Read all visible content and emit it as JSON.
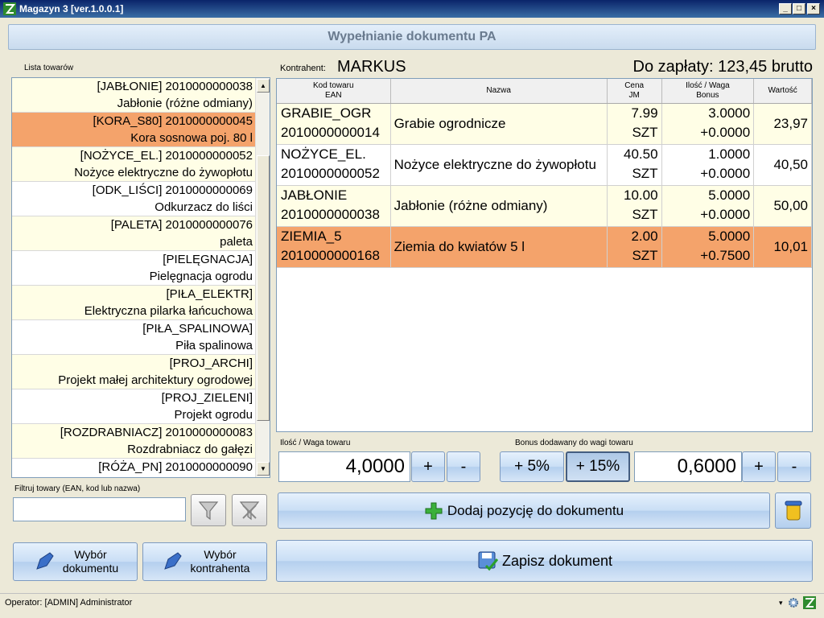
{
  "window": {
    "title": "Magazyn 3 [ver.1.0.0.1]"
  },
  "header": {
    "title": "Wypełnianie dokumentu PA"
  },
  "products": {
    "label": "Lista towarów",
    "items": [
      {
        "code": "[JABŁONIE] 2010000000038",
        "name": "Jabłonie (różne odmiany)",
        "style": "y"
      },
      {
        "code": "[KORA_S80] 2010000000045",
        "name": "Kora sosnowa poj. 80 l",
        "style": "sel"
      },
      {
        "code": "[NOŻYCE_EL.] 2010000000052",
        "name": "Nożyce elektryczne do żywopłotu",
        "style": "y"
      },
      {
        "code": "[ODK_LIŚCI] 2010000000069",
        "name": "Odkurzacz do liści",
        "style": "w"
      },
      {
        "code": "[PALETA] 2010000000076",
        "name": "paleta",
        "style": "y"
      },
      {
        "code": "[PIELĘGNACJA]",
        "name": "Pielęgnacja ogrodu",
        "style": "w"
      },
      {
        "code": "[PIŁA_ELEKTR]",
        "name": "Elektryczna pilarka łańcuchowa",
        "style": "y"
      },
      {
        "code": "[PIŁA_SPALINOWA]",
        "name": "Piła spalinowa",
        "style": "w"
      },
      {
        "code": "[PROJ_ARCHI]",
        "name": "Projekt małej architektury ogrodowej",
        "style": "y"
      },
      {
        "code": "[PROJ_ZIELENI]",
        "name": "Projekt ogrodu",
        "style": "w"
      },
      {
        "code": "[ROZDRABNIACZ] 2010000000083",
        "name": "Rozdrabniacz do gałęzi",
        "style": "y"
      },
      {
        "code": "[RÓŻA_PN] 2010000000090",
        "name": "",
        "style": "w"
      }
    ]
  },
  "filter": {
    "label": "Filtruj towary (EAN, kod lub nazwa)",
    "value": ""
  },
  "buttons": {
    "choose_doc_l1": "Wybór",
    "choose_doc_l2": "dokumentu",
    "choose_contr_l1": "Wybór",
    "choose_contr_l2": "kontrahenta",
    "add_position": "Dodaj pozycję do dokumentu",
    "save_doc": "Zapisz dokument",
    "qty_plus": "+",
    "qty_minus": "-",
    "bonus5": "+ 5%",
    "bonus15": "+ 15%",
    "bonus_plus": "+",
    "bonus_minus": "-"
  },
  "contractor": {
    "label": "Kontrahent:",
    "value": "MARKUS"
  },
  "to_pay": "Do zapłaty: 123,45 brutto",
  "table": {
    "headers": {
      "code_l1": "Kod towaru",
      "code_l2": "EAN",
      "name": "Nazwa",
      "price_l1": "Cena",
      "price_l2": "JM",
      "qty_l1": "Ilość / Waga",
      "qty_l2": "Bonus",
      "value": "Wartość"
    },
    "rows": [
      {
        "code": "GRABIE_OGR",
        "ean": "2010000000014",
        "name": "Grabie ogrodnicze",
        "price": "7.99",
        "unit": "SZT",
        "qty": "3.0000",
        "bonus": "+0.0000",
        "value": "23,97",
        "style": "y"
      },
      {
        "code": "NOŻYCE_EL.",
        "ean": "2010000000052",
        "name": "Nożyce elektryczne do żywopłotu",
        "price": "40.50",
        "unit": "SZT",
        "qty": "1.0000",
        "bonus": "+0.0000",
        "value": "40,50",
        "style": "w"
      },
      {
        "code": "JABŁONIE",
        "ean": "2010000000038",
        "name": "Jabłonie (różne odmiany)",
        "price": "10.00",
        "unit": "SZT",
        "qty": "5.0000",
        "bonus": "+0.0000",
        "value": "50,00",
        "style": "y"
      },
      {
        "code": "ZIEMIA_5",
        "ean": "2010000000168",
        "name": "Ziemia do kwiatów 5 l",
        "price": "2.00",
        "unit": "SZT",
        "qty": "5.0000",
        "bonus": "+0.7500",
        "value": "10,01",
        "style": "sel"
      }
    ]
  },
  "qty": {
    "label": "Ilość / Waga towaru",
    "value": "4,0000"
  },
  "bonus": {
    "label": "Bonus dodawany do wagi towaru",
    "value": "0,6000"
  },
  "status": {
    "operator": "Operator: [ADMIN] Administrator"
  },
  "colors": {
    "selected_row": "#f4a36b",
    "alt_row": "#fffee6",
    "button_blue": "#c9def5"
  }
}
